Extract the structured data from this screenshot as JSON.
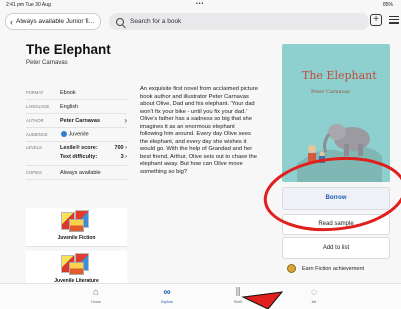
{
  "status_bar": {
    "time": "2:41 pm  Tue 30 Aug",
    "dots": "•••",
    "battery": "85%"
  },
  "nav": {
    "back_label": "Always available Junior fi...",
    "search_placeholder": "Search for a book"
  },
  "book": {
    "title": "The Elephant",
    "author": "Peter Carnavas",
    "description": "An exquisite first novel from acclaimed picture book author and illustrator Peter Carnavas about Olive, Dad and his elephant. 'Your dad won't fix your bike - until you fix your dad.' Olive's father has a sadness so big that she imagines it as an enormous elephant following him around. Every day Olive sees the elephant, and every day she wishes it would go. With the help of Grandad and her best friend, Arthur, Olive sets out to chase the elephant away. But how can Olive move something so big?",
    "cover_title": "The Elephant",
    "cover_author": "Peter Carnavas"
  },
  "details": {
    "format_label": "FORMAT",
    "format_value": "Ebook",
    "language_label": "LANGUAGE",
    "language_value": "English",
    "author_label": "AUTHOR",
    "author_value": "Peter Carnavas",
    "audience_label": "AUDIENCE",
    "audience_value": "Juvenile",
    "levels_label": "LEVELS",
    "lexile_label": "Lexile® score:",
    "lexile_value": "700",
    "difficulty_label": "Text difficulty:",
    "difficulty_value": "3",
    "copies_label": "COPIES",
    "copies_value": "Always available"
  },
  "series": [
    {
      "label": "Juvenile Fiction"
    },
    {
      "label": "Juvenile Literature"
    }
  ],
  "actions": {
    "borrow": "Borrow",
    "sample": "Read sample",
    "add_to_list": "Add to list",
    "achievement": "Earn Fiction achievement"
  },
  "tabs": [
    {
      "label": "Home"
    },
    {
      "label": "Explore"
    },
    {
      "label": "Shelf"
    },
    {
      "label": "Me"
    }
  ],
  "colors": {
    "accent": "#1c58b3",
    "annotation": "#e0201c",
    "cover_bg": "#8ed0cf"
  }
}
